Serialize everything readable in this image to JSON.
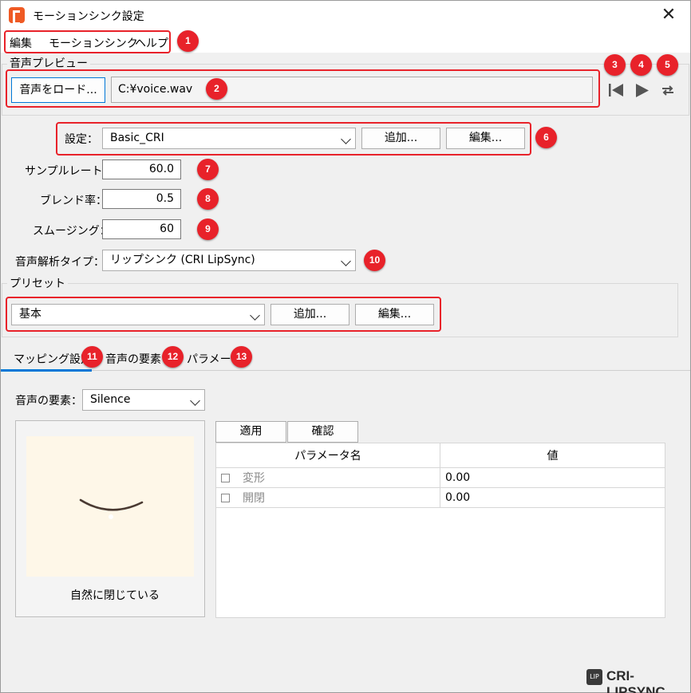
{
  "window": {
    "title": "モーションシンク設定",
    "close_glyph": "✕"
  },
  "menu": {
    "items": [
      "編集",
      "モーションシンク",
      "ヘルプ"
    ]
  },
  "audio_preview": {
    "group_label": "音声プレビュー",
    "load_button": "音声をロード...",
    "file_path": "C:¥voice.wav",
    "icons": [
      "skip-to-start-icon",
      "play-icon",
      "loop-icon"
    ]
  },
  "settings": {
    "label": "設定：",
    "selected": "Basic_CRI",
    "add_button": "追加...",
    "edit_button": "編集..."
  },
  "sample_rate": {
    "label": "サンプルレート：",
    "value": "60.0"
  },
  "blend_rate": {
    "label": "ブレンド率：",
    "value": "0.5"
  },
  "smoothing": {
    "label": "スムージング：",
    "value": "60"
  },
  "analysis_type": {
    "label": "音声解析タイプ：",
    "selected": "リップシンク (CRI LipSync)"
  },
  "preset": {
    "group_label": "プリセット",
    "selected": "基本",
    "add_button": "追加...",
    "edit_button": "編集..."
  },
  "tabs": [
    {
      "label": "マッピング設定",
      "active": true
    },
    {
      "label": "音声の要素",
      "active": false
    },
    {
      "label": "パラメータ",
      "active": false
    }
  ],
  "audio_element": {
    "label": "音声の要素：",
    "selected": "Silence"
  },
  "preview": {
    "caption": "自然に閉じている"
  },
  "actions": {
    "apply_button": "適用",
    "confirm_button": "確認"
  },
  "param_table": {
    "headers": [
      "パラメータ名",
      "値"
    ],
    "rows": [
      {
        "name": "変形",
        "value": "0.00"
      },
      {
        "name": "開閉",
        "value": "0.00"
      }
    ]
  },
  "badges": [
    "1",
    "2",
    "3",
    "4",
    "5",
    "6",
    "7",
    "8",
    "9",
    "10",
    "11",
    "12",
    "13"
  ],
  "logo": {
    "text": "CRI-LIPSYNC",
    "icon_text": "LIP"
  },
  "colors": {
    "accent": "#0078d7",
    "annotation_red": "#e8222a",
    "brand_orange": "#ef5a24"
  }
}
